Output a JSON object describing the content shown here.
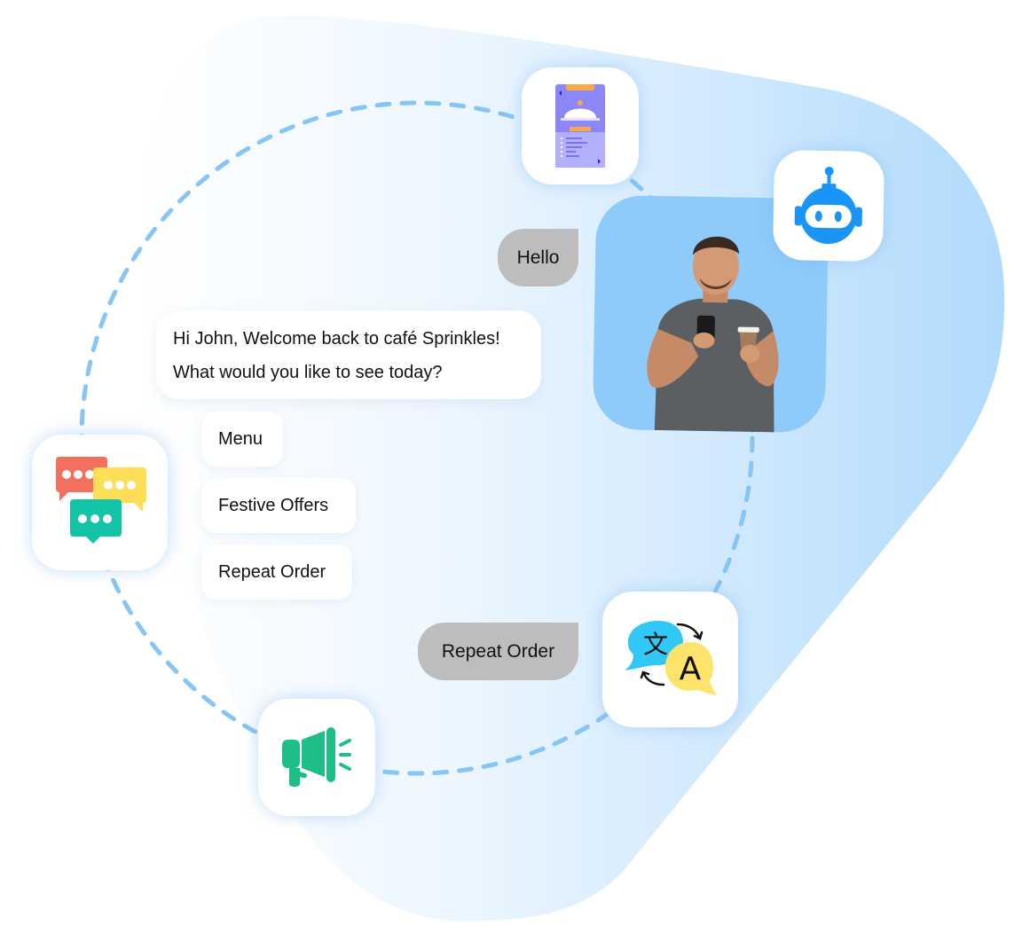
{
  "colors": {
    "blob_light": "#f7fbff",
    "blob_dark": "#b3dcfc",
    "dashed_circle": "#86c5f6",
    "photo_bg": "#8ecbfb",
    "user_bubble": "#bdbdbd",
    "robot_blue": "#1a95f5",
    "megaphone_green": "#1dbf86",
    "chat_red": "#f2705d",
    "chat_yellow": "#fedd57",
    "chat_teal": "#13c3a5",
    "translate_cyan": "#32c8f5",
    "translate_yellow": "#fde36b",
    "menu_phone_purple": "#8c87f9",
    "menu_phone_orange": "#f8a847"
  },
  "icons": {
    "menu_app": "menu-app-icon",
    "robot": "robot-icon",
    "chat_bubbles": "chat-bubbles-icon",
    "megaphone": "megaphone-icon",
    "translate": "translate-icon",
    "person_photo": "person-with-phone-and-coffee"
  },
  "conversation": {
    "user_greeting": "Hello",
    "bot_message_line1": "Hi John, Welcome back to café Sprinkles!",
    "bot_message_line2": "What would you like to see today?",
    "quick_replies": [
      {
        "label": "Menu"
      },
      {
        "label": "Festive Offers"
      },
      {
        "label": "Repeat Order"
      }
    ],
    "user_reply": "Repeat Order"
  },
  "translate_icon_glyphs": {
    "source": "文",
    "target": "A"
  }
}
